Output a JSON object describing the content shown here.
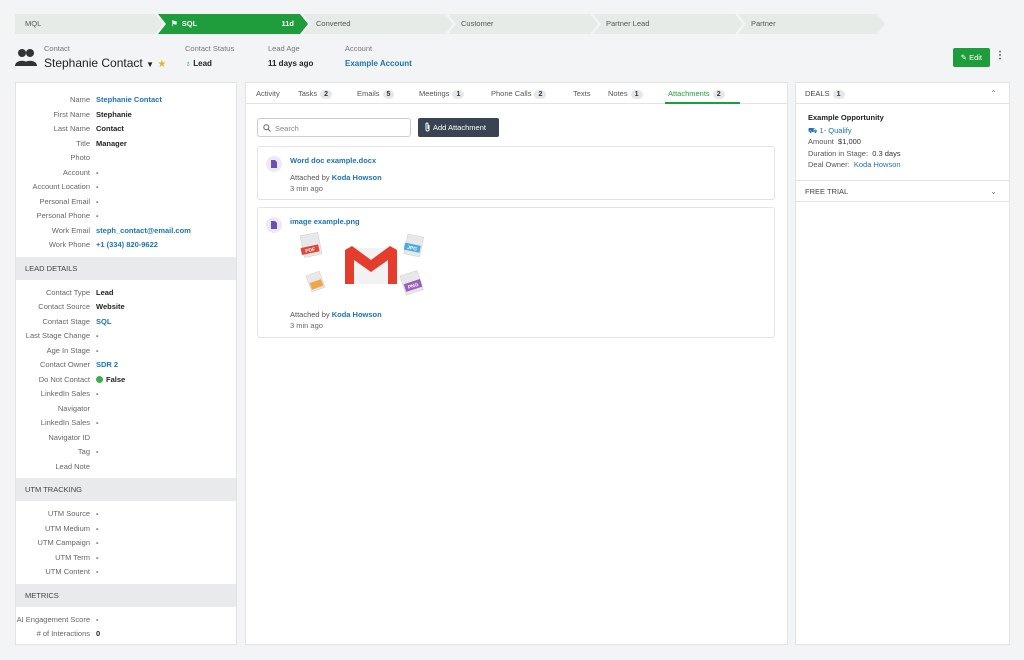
{
  "stages": [
    {
      "label": "MQL",
      "days": "",
      "active": false
    },
    {
      "label": "SQL",
      "days": "11d",
      "active": true
    },
    {
      "label": "Converted",
      "days": "",
      "active": false
    },
    {
      "label": "Customer",
      "days": "",
      "active": false
    },
    {
      "label": "Partner Lead",
      "days": "",
      "active": false
    },
    {
      "label": "Partner",
      "days": "",
      "active": false
    }
  ],
  "header": {
    "contact_label": "Contact",
    "contact_name": "Stephanie Contact",
    "status_label": "Contact Status",
    "status_value": "Lead",
    "age_label": "Lead Age",
    "age_value": "11 days ago",
    "account_label": "Account",
    "account_value": "Example Account",
    "edit_label": "Edit"
  },
  "details": {
    "contact": [
      {
        "k": "Name",
        "v": "Stephanie Contact",
        "link": true
      },
      {
        "k": "First Name",
        "v": "Stephanie"
      },
      {
        "k": "Last Name",
        "v": "Contact"
      },
      {
        "k": "Title",
        "v": "Manager"
      },
      {
        "k": "Photo",
        "v": ""
      },
      {
        "k": "Account",
        "v": "-"
      },
      {
        "k": "Account Location",
        "v": "-"
      },
      {
        "k": "Personal Email",
        "v": "-"
      },
      {
        "k": "Personal Phone",
        "v": "-"
      },
      {
        "k": "Work Email",
        "v": "steph_contact@email.com",
        "link": true
      },
      {
        "k": "Work Phone",
        "v": "+1 (334) 820-9622",
        "link": true
      }
    ],
    "lead_title": "LEAD DETAILS",
    "lead": [
      {
        "k": "Contact Type",
        "v": "Lead"
      },
      {
        "k": "Contact Source",
        "v": "Website"
      },
      {
        "k": "Contact Stage",
        "v": "SQL",
        "link": true
      },
      {
        "k": "Last Stage Change",
        "v": "-"
      },
      {
        "k": "Age In Stage",
        "v": "-"
      },
      {
        "k": "Contact Owner",
        "v": "SDR 2",
        "link": true
      },
      {
        "k": "Do Not Contact",
        "v": "False",
        "dot": true
      },
      {
        "k": "LinkedIn Sales Navigator",
        "v": "-"
      },
      {
        "k": "LinkedIn Sales Navigator ID",
        "v": "-"
      },
      {
        "k": "Tag",
        "v": "-"
      },
      {
        "k": "Lead Note",
        "v": ""
      }
    ],
    "utm_title": "UTM TRACKING",
    "utm": [
      {
        "k": "UTM Source",
        "v": "-"
      },
      {
        "k": "UTM Medium",
        "v": "-"
      },
      {
        "k": "UTM Campaign",
        "v": "-"
      },
      {
        "k": "UTM Term",
        "v": "-"
      },
      {
        "k": "UTM Content",
        "v": "-"
      }
    ],
    "metrics_title": "METRICS",
    "metrics": [
      {
        "k": "AI Engagement Score",
        "v": "-"
      },
      {
        "k": "# of Interactions",
        "v": "0"
      }
    ]
  },
  "tabs": [
    {
      "label": "Activity",
      "count": ""
    },
    {
      "label": "Tasks",
      "count": "2"
    },
    {
      "label": "Emails",
      "count": "5"
    },
    {
      "label": "Meetings",
      "count": "1"
    },
    {
      "label": "Phone Calls",
      "count": "2"
    },
    {
      "label": "Texts",
      "count": ""
    },
    {
      "label": "Notes",
      "count": "1"
    },
    {
      "label": "Attachments",
      "count": "2"
    }
  ],
  "search_placeholder": "Search",
  "add_attachment_label": "Add Attachment",
  "attachments": [
    {
      "name": "Word doc example.docx",
      "attached_by_label": "Attached by",
      "user": "Koda Howson",
      "time": "3 min ago"
    },
    {
      "name": "image example.png",
      "attached_by_label": "Attached by",
      "user": "Koda Howson",
      "time": "3 min ago",
      "preview_badges": [
        "PDF",
        "JPG",
        "PNG"
      ]
    }
  ],
  "deals": {
    "title": "DEALS",
    "count": "1",
    "name": "Example Opportunity",
    "stage": "1- Qualify",
    "amount_label": "Amount",
    "amount": "$1,000",
    "duration_label": "Duration in Stage:",
    "duration": "0.3 days",
    "owner_label": "Deal Owner:",
    "owner": "Koda Howson"
  },
  "free_trial_title": "FREE TRIAL",
  "colors": {
    "accent": "#1f9d3d",
    "link": "#1d74b8",
    "dark_button": "#394453"
  }
}
